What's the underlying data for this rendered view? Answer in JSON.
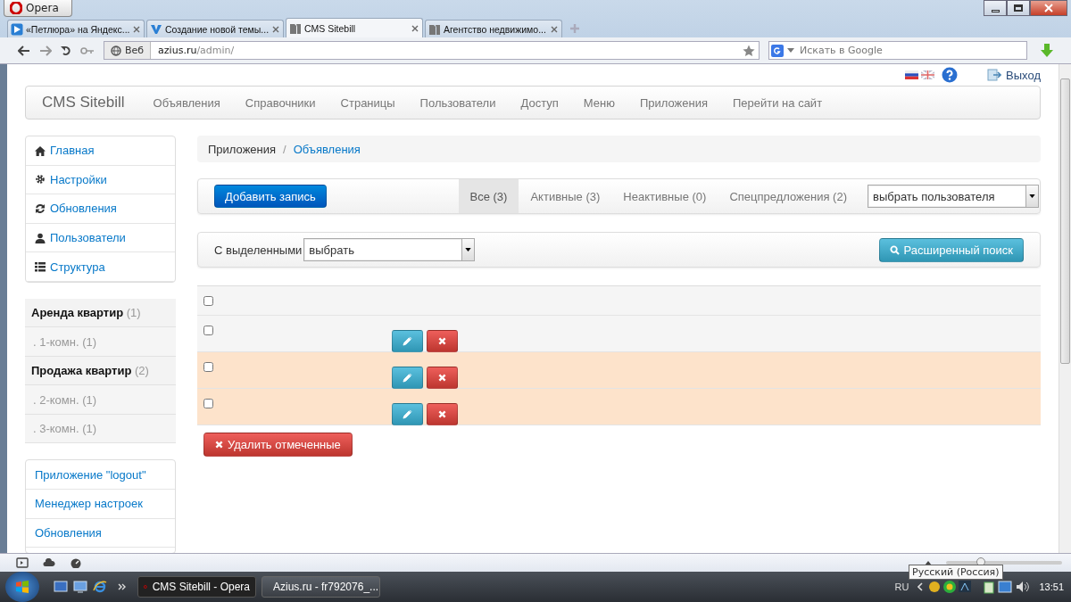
{
  "browser": {
    "menu_button": "Opera",
    "tabs": [
      {
        "title": "«Петлюра» на Яндекс...",
        "selected": false
      },
      {
        "title": "Создание новой темы...",
        "selected": false
      },
      {
        "title": "CMS Sitebill",
        "selected": true
      },
      {
        "title": "Агентство недвижимо...",
        "selected": false
      }
    ],
    "address_label": "Веб",
    "address_host": "azius.ru",
    "address_path": "/admin/",
    "search_placeholder": "Искать в Google"
  },
  "topbar": {
    "logout": "Выход"
  },
  "navbar": {
    "brand": "CMS Sitebill",
    "items": [
      "Объявления",
      "Справочники",
      "Страницы",
      "Пользователи",
      "Доступ",
      "Меню",
      "Приложения",
      "Перейти на сайт"
    ]
  },
  "sidebar": {
    "menu": [
      {
        "label": "Главная"
      },
      {
        "label": "Настройки"
      },
      {
        "label": "Обновления"
      },
      {
        "label": "Пользователи"
      },
      {
        "label": "Структура"
      }
    ],
    "categories": [
      {
        "label": "Аренда квартир",
        "count": "(1)",
        "children": [
          {
            "label": ". 1-комн.",
            "count": "(1)"
          }
        ]
      },
      {
        "label": "Продажа квартир",
        "count": "(2)",
        "children": [
          {
            "label": ". 2-комн.",
            "count": "(1)"
          },
          {
            "label": ". 3-комн.",
            "count": "(1)"
          }
        ]
      }
    ],
    "apps": [
      "Приложение \"logout\"",
      "Менеджер настроек",
      "Обновления"
    ]
  },
  "breadcrumb": {
    "items": [
      "Приложения",
      "Объявления"
    ],
    "separator": "/"
  },
  "toolbar": {
    "add_button": "Добавить запись",
    "filters": [
      {
        "label": "Все (3)",
        "selected": true
      },
      {
        "label": "Активные (3)",
        "selected": false
      },
      {
        "label": "Неактивные (0)",
        "selected": false
      },
      {
        "label": "Спецпредложения (2)",
        "selected": false
      }
    ],
    "user_select": "выбрать пользователя"
  },
  "bulk": {
    "label": "С выделенными",
    "select": "выбрать",
    "search_button": "Расширенный поиск"
  },
  "table": {
    "header_checked": false,
    "rows": [
      {
        "checked": false,
        "highlighted": false
      },
      {
        "checked": false,
        "highlighted": true
      },
      {
        "checked": false,
        "highlighted": true
      }
    ]
  },
  "delete_button": "Удалить отмеченные",
  "statusbar": {
    "zoom": {
      "level": 0.3
    },
    "tooltip": "Русский (Россия)"
  },
  "taskbar": {
    "windows": [
      {
        "title": "CMS Sitebill - Opera",
        "selected": true
      },
      {
        "title": "Azius.ru - fr792076_...",
        "selected": false
      }
    ],
    "lang": "RU",
    "time": "13:51"
  }
}
